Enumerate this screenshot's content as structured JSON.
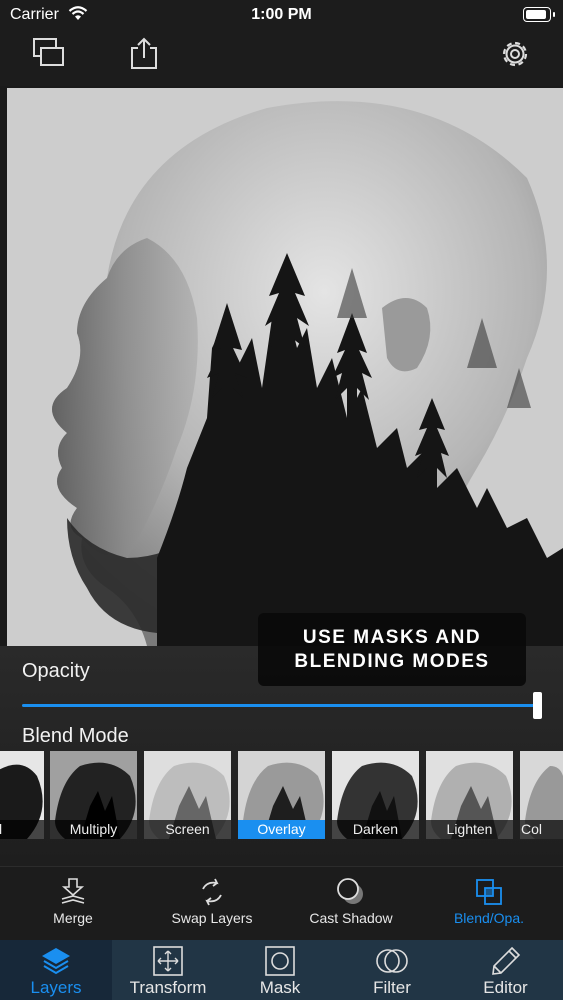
{
  "status_bar": {
    "carrier": "Carrier",
    "time": "1:00 PM"
  },
  "toolbar": {
    "icons": [
      "layers-copy-icon",
      "share-icon",
      "gear-icon"
    ]
  },
  "promo": {
    "text": "USE MASKS AND BLENDING MODES"
  },
  "opacity": {
    "label": "Opacity",
    "value": 1.0
  },
  "blend_mode": {
    "label": "Blend Mode",
    "options": [
      "l",
      "Multiply",
      "Screen",
      "Overlay",
      "Darken",
      "Lighten",
      "Col"
    ],
    "selected": "Overlay"
  },
  "actions": [
    {
      "label": "Merge",
      "icon": "merge-icon"
    },
    {
      "label": "Swap Layers",
      "icon": "swap-icon"
    },
    {
      "label": "Cast Shadow",
      "icon": "shadow-icon"
    },
    {
      "label": "Blend/Opa.",
      "icon": "blend-icon",
      "active": true
    }
  ],
  "tabs": [
    {
      "label": "Layers",
      "icon": "layers-icon",
      "active": true
    },
    {
      "label": "Transform",
      "icon": "transform-icon"
    },
    {
      "label": "Mask",
      "icon": "mask-icon"
    },
    {
      "label": "Filter",
      "icon": "filter-icon"
    },
    {
      "label": "Editor",
      "icon": "pencil-icon"
    }
  ],
  "colors": {
    "accent": "#1a8ff0",
    "tabbar": "#213545",
    "tab_active": "#172839",
    "background": "#1a1a1a"
  }
}
